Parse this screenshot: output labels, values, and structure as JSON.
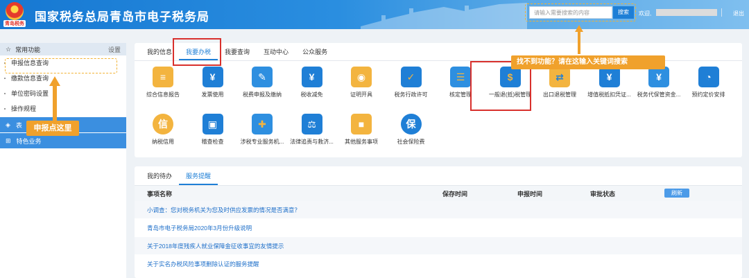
{
  "header": {
    "title": "国家税务总局青岛市电子税务局",
    "emblem_text": "青岛税务",
    "search_placeholder": "请输入需要搜索的内容",
    "search_button": "搜索",
    "welcome": "欢迎,",
    "logout": "退出"
  },
  "sidebar": {
    "title": "常用功能",
    "settings": "设置",
    "items": [
      "申报信息查询",
      "缴款信息查询",
      "单位密码设置",
      "操作规程"
    ],
    "section2": "表",
    "section3": "特色业务"
  },
  "main_tabs": [
    "我的信息",
    "我要办税",
    "我要查询",
    "互动中心",
    "公众服务"
  ],
  "functions": [
    {
      "label": "综合信息报告",
      "icon": "report-icon"
    },
    {
      "label": "发票使用",
      "icon": "invoice-icon"
    },
    {
      "label": "税费申报及缴纳",
      "icon": "declare-icon"
    },
    {
      "label": "税收减免",
      "icon": "tax-reduce-icon"
    },
    {
      "label": "证明开具",
      "icon": "certificate-icon"
    },
    {
      "label": "税务行政许可",
      "icon": "permit-icon"
    },
    {
      "label": "核定管理",
      "icon": "approve-icon"
    },
    {
      "label": "一般退(抵)税管理",
      "icon": "refund-icon"
    },
    {
      "label": "出口退税管理",
      "icon": "export-icon"
    },
    {
      "label": "增值税抵扣凭证...",
      "icon": "vat-icon"
    },
    {
      "label": "税务代保管资金...",
      "icon": "custody-icon"
    },
    {
      "label": "预约定价安排",
      "icon": "pricing-icon"
    },
    {
      "label": "纳税信用",
      "icon": "credit-icon"
    },
    {
      "label": "稽查检查",
      "icon": "inspect-icon"
    },
    {
      "label": "涉税专业服务机...",
      "icon": "agency-icon"
    },
    {
      "label": "法律追责与救济...",
      "icon": "law-icon"
    },
    {
      "label": "其他服务事项",
      "icon": "other-icon"
    },
    {
      "label": "社会保险费",
      "icon": "insurance-icon"
    }
  ],
  "todo": {
    "tabs": [
      "我的待办",
      "服务提醒"
    ],
    "columns": [
      "事项名称",
      "保存时间",
      "申报时间",
      "审批状态"
    ],
    "refresh": "刷新",
    "rows": [
      "小调查：您对税务机关为您及时供应发票的情况是否满意？",
      "青岛市电子税务局2020年3月份升级说明",
      "关于2018年度残疾人就业保障金征收事宜的友情提示",
      "关于实名办税风险事项删除认证的服务提醒"
    ]
  },
  "annotations": {
    "search_tip": "找不到功能？请在这输入关键词搜索",
    "sidebar_tip": "申报点这里"
  },
  "colors": {
    "primary": "#1e7fd6",
    "annotation": "#f0a12c",
    "highlight": "#d8302c"
  }
}
